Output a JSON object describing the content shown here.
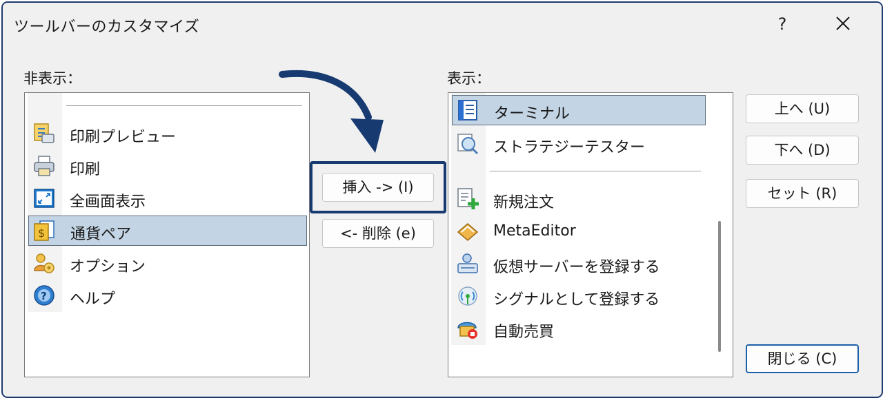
{
  "window": {
    "title": "ツールバーのカスタマイズ",
    "help": "?"
  },
  "hidden_panel": {
    "label": "非表示：",
    "items": [
      {
        "label": "印刷プレビュー",
        "icon": "print-preview-icon"
      },
      {
        "label": "印刷",
        "icon": "printer-icon"
      },
      {
        "label": "全画面表示",
        "icon": "fullscreen-icon"
      },
      {
        "label": "通貨ペア",
        "icon": "currency-pair-icon",
        "selected": true
      },
      {
        "label": "オプション",
        "icon": "options-icon"
      },
      {
        "label": "ヘルプ",
        "icon": "help-icon"
      }
    ]
  },
  "shown_panel": {
    "label": "表示：",
    "items": [
      {
        "label": "ターミナル",
        "icon": "terminal-icon",
        "selected": true
      },
      {
        "label": "ストラテジーテスター",
        "icon": "strategy-tester-icon"
      },
      {
        "label": "新規注文",
        "icon": "new-order-icon"
      },
      {
        "label": "MetaEditor",
        "icon": "metaeditor-icon"
      },
      {
        "label": "仮想サーバーを登録する",
        "icon": "virtual-server-icon"
      },
      {
        "label": "シグナルとして登録する",
        "icon": "signal-icon"
      },
      {
        "label": "自動売買",
        "icon": "auto-trading-icon"
      }
    ]
  },
  "buttons": {
    "insert": "挿入 -> (I)",
    "remove": "<- 削除 (e)",
    "up": "上へ (U)",
    "down": "下へ (D)",
    "reset": "セット (R)",
    "close": "閉じる (C)"
  },
  "colors": {
    "selection": "#c3d4e4",
    "accent": "#173a70"
  }
}
